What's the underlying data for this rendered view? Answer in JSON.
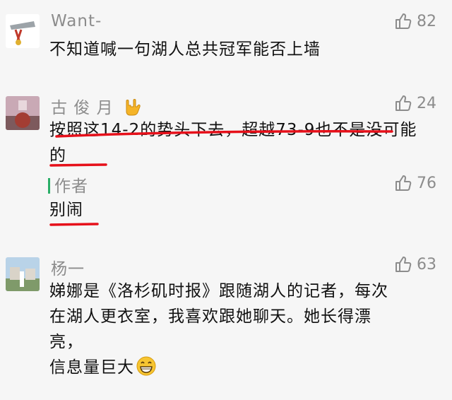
{
  "comments": [
    {
      "name": "Want-",
      "likes": "82",
      "text": "不知道喊一句湖人总共冠军能否上墙"
    },
    {
      "name": "古 俊 月",
      "likes": "24",
      "text": "按照这14-2的势头下去，超越73-9也不是没可能的",
      "reply": {
        "name": "作者",
        "likes": "76",
        "text": "别闹"
      }
    },
    {
      "name": "杨一",
      "likes": "63",
      "text_lines": [
        "娣娜是《洛杉矶时报》跟随湖人的记者，每次",
        "在湖人更衣室，我喜欢跟她聊天。她长得漂",
        "亮，",
        "信息量巨大"
      ]
    }
  ],
  "icons": {
    "like": "thumbs-up-icon",
    "name_badge": "love-you-hand-emoji-icon",
    "smile": "grinning-face-emoji-icon"
  },
  "colors": {
    "meta_text": "#8c8c8c",
    "body_text": "#111111",
    "author_bar": "#2aae67",
    "annotation": "#e6101a"
  }
}
